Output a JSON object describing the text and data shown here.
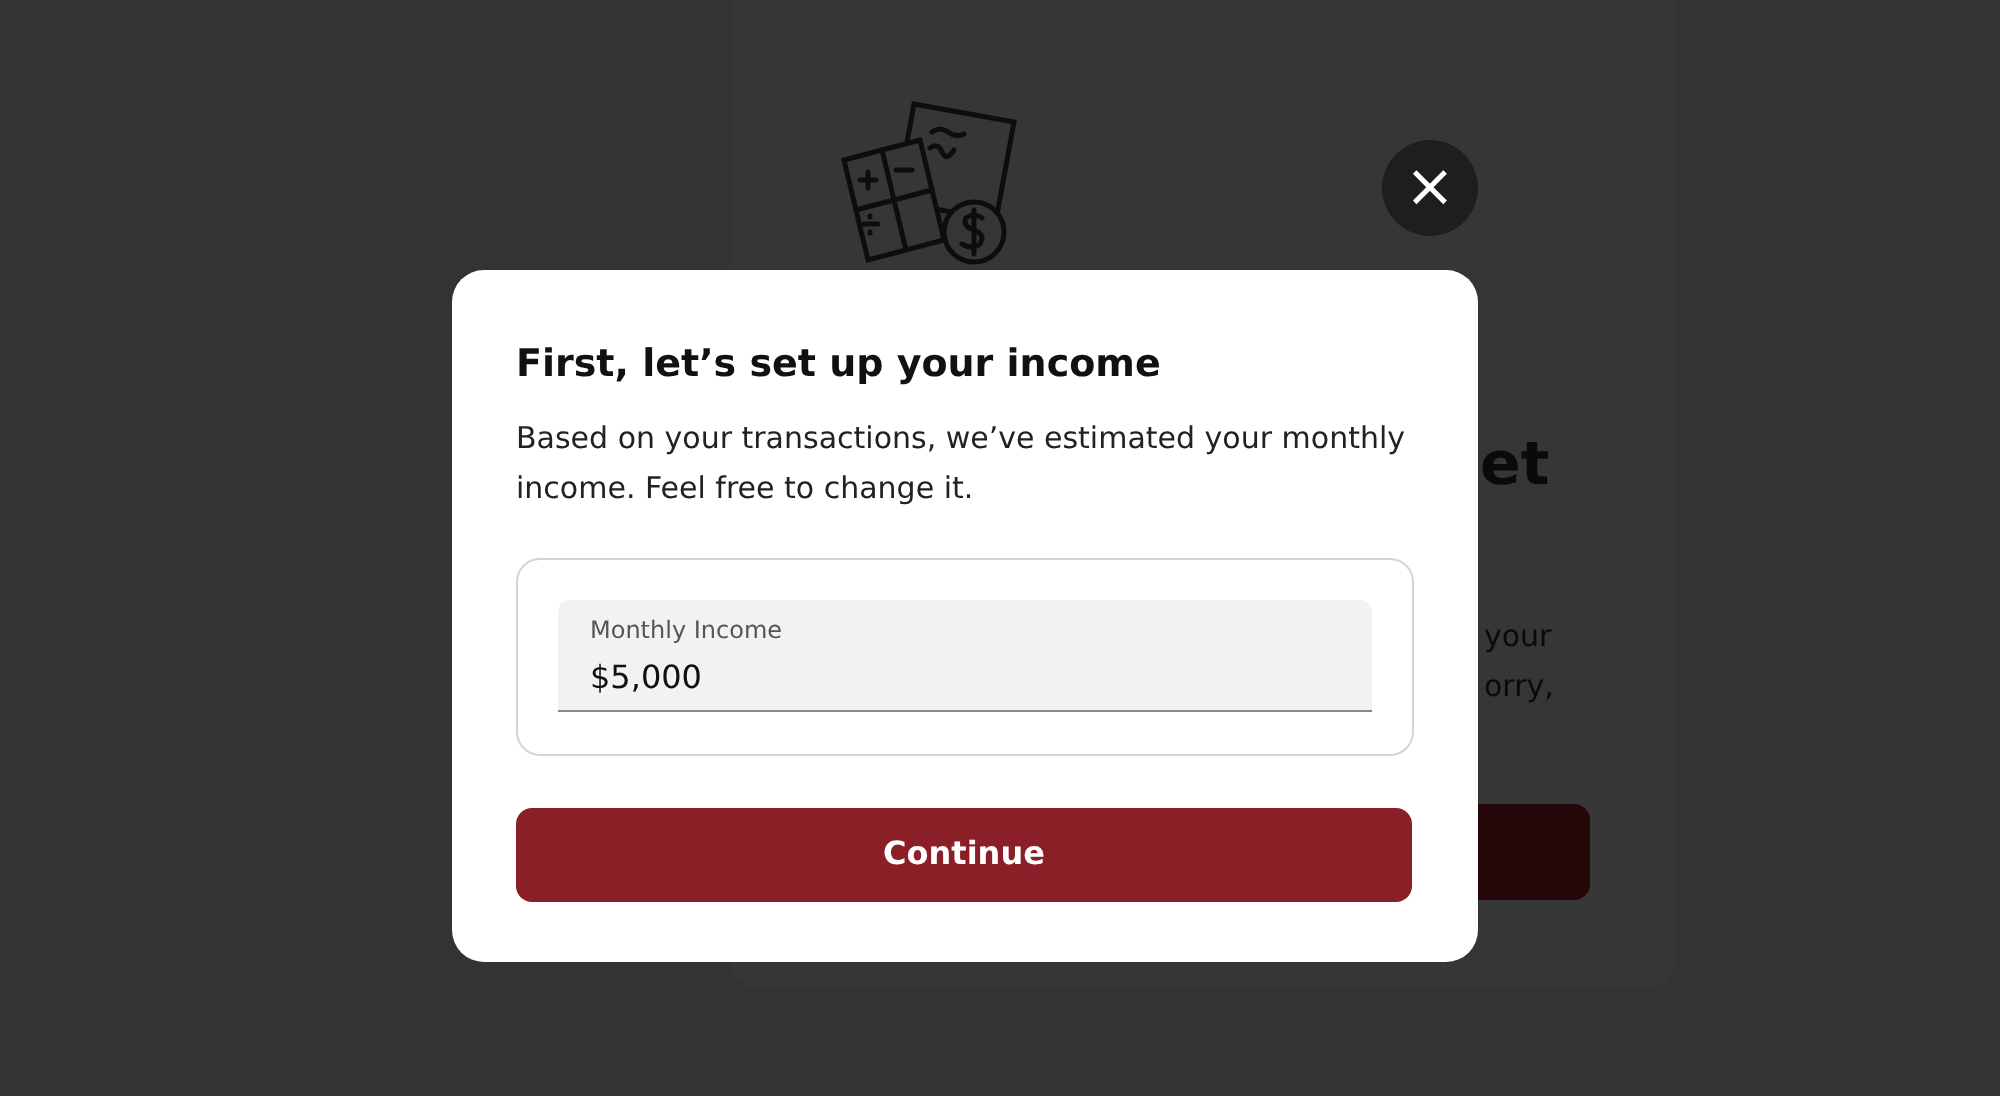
{
  "background_page": {
    "heading_fragment": "et",
    "body_fragments": [
      "your",
      "orry,"
    ],
    "close_button": {
      "label": "×"
    }
  },
  "dialog": {
    "title": "First, let’s set up your income",
    "description": "Based on your transactions, we’ve estimated your monthly income. Feel free to change it.",
    "field": {
      "label": "Monthly Income",
      "value": "$5,000"
    },
    "button": "Continue"
  }
}
